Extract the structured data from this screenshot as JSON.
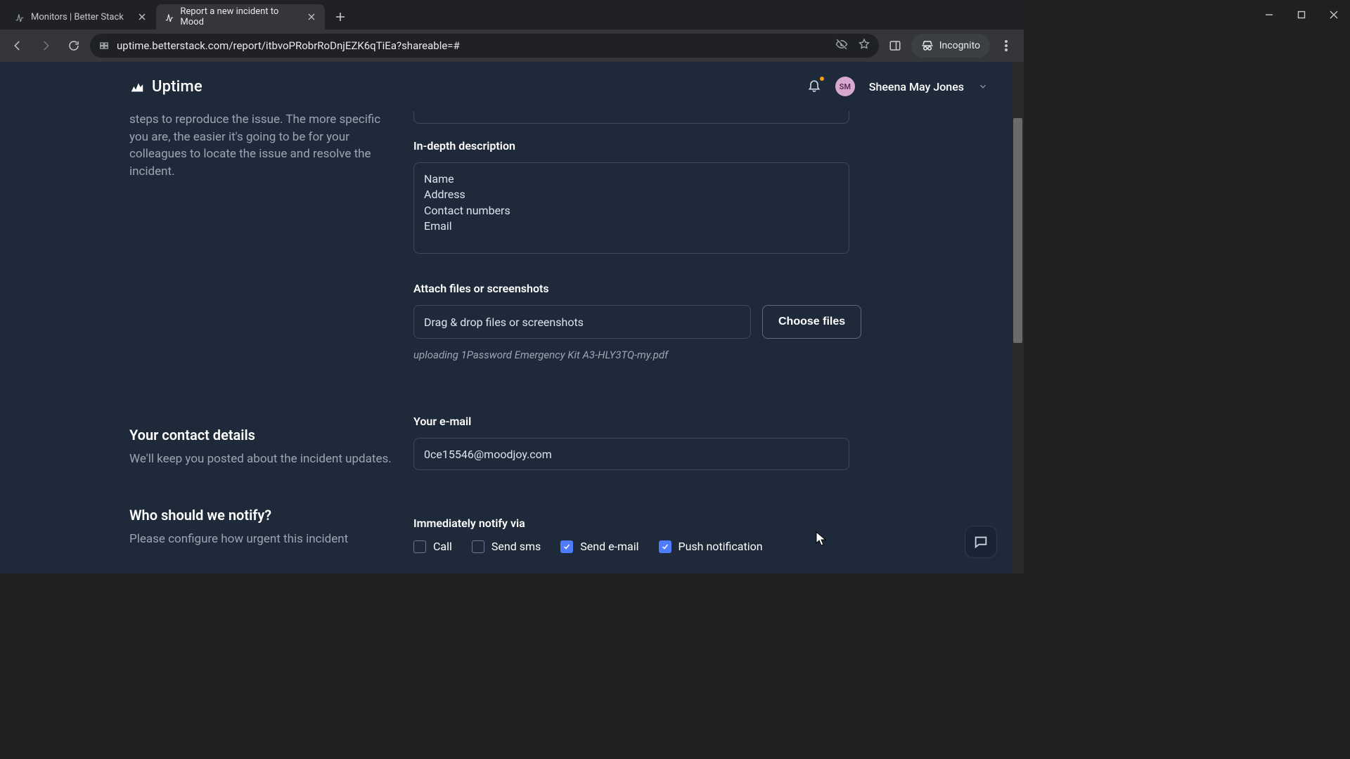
{
  "browser": {
    "tabs": [
      {
        "title": "Monitors | Better Stack"
      },
      {
        "title": "Report a new incident to Mood"
      }
    ],
    "url": "uptime.betterstack.com/report/itbvoPRobrRoDnjEZK6qTiEa?shareable=#",
    "incognito_label": "Incognito"
  },
  "app": {
    "brand": "Uptime",
    "user": {
      "initials": "SM",
      "name": "Sheena May Jones"
    }
  },
  "left": {
    "help_top": "steps to reproduce the issue. The more specific you are, the easier it's going to be for your colleagues to locate the issue and resolve the incident.",
    "contact": {
      "title": "Your contact details",
      "help": "We'll keep you posted about the incident updates."
    },
    "notify": {
      "title": "Who should we notify?",
      "help": "Please configure how urgent this incident"
    }
  },
  "form": {
    "description_label": "In-depth description",
    "description_value": "Name\nAddress\nContact numbers\nEmail",
    "attach_label": "Attach files or screenshots",
    "dropzone_text": "Drag & drop files or screenshots",
    "choose_files": "Choose files",
    "uploading": "uploading 1Password Emergency Kit A3-HLY3TQ-my.pdf",
    "email_label": "Your e-mail",
    "email_value": "0ce15546@moodjoy.com",
    "notify_via_label": "Immediately notify via",
    "options": {
      "call": "Call",
      "sms": "Send sms",
      "email": "Send e-mail",
      "push": "Push notification"
    }
  }
}
